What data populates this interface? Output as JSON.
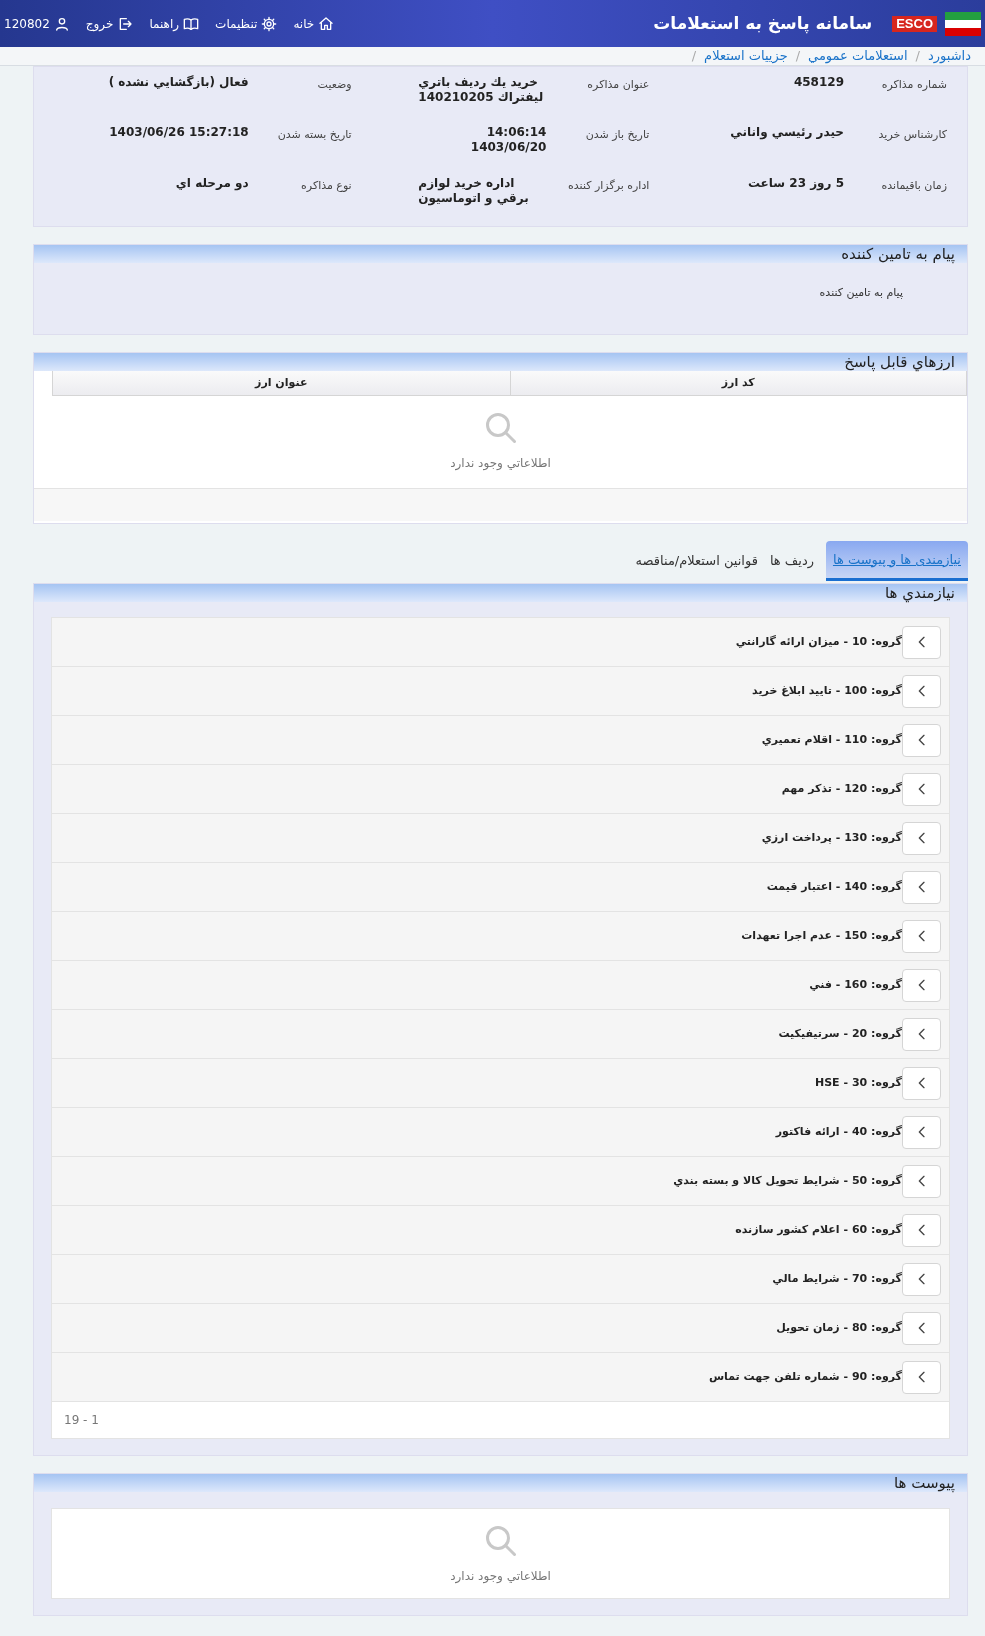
{
  "header": {
    "title": "سامانه پاسخ به استعلامات",
    "logo_text": "ESCO",
    "nav": [
      {
        "kind": "home",
        "label": "خانه"
      },
      {
        "kind": "settings",
        "label": "تنظيمات"
      },
      {
        "kind": "guide",
        "label": "راهنما"
      },
      {
        "kind": "exit",
        "label": "خروج"
      },
      {
        "kind": "user",
        "label": "120802"
      }
    ]
  },
  "breadcrumb": [
    "داشبورد",
    "استعلامات عمومي",
    "جزييات استعلام"
  ],
  "breadcrumb_separator": "/",
  "details": [
    {
      "label": "شماره مذاكره",
      "value": "458129"
    },
    {
      "label": "عنوان مذاكره",
      "value": "خريد يك رديف باتري ليفتراك 140210205"
    },
    {
      "label": "وضعيت",
      "value": "فعال (بازگشايي نشده )"
    },
    {
      "label": "كارشناس خريد",
      "value": "حيدر رئيسي واناني"
    },
    {
      "label": "تاريخ باز شدن",
      "value": "14:06:14 1403/06/20"
    },
    {
      "label": "تاريخ بسته شدن",
      "value": "1403/06/26 15:27:18"
    },
    {
      "label": "زمان باقيمانده",
      "value": "5 روز 23 ساعت"
    },
    {
      "label": "اداره برگزار كننده",
      "value": "اداره خريد لوازم برقي و اتوماسيون"
    },
    {
      "label": "نوع مذاكره",
      "value": "دو مرحله اي"
    }
  ],
  "message_panel": {
    "title": "پيام به تامين كننده",
    "text": "پيام به تامين كننده"
  },
  "currency_panel": {
    "title": "ارزهاي قابل پاسخ",
    "columns": [
      "كد ارز",
      "عنوان ارز"
    ],
    "empty_text": "اطلاعاتي وجود ندارد"
  },
  "tabs": [
    {
      "label": "نيازمندی ها و پیوست ها",
      "selected": true
    },
    {
      "label": "رديف ها",
      "selected": false
    },
    {
      "label": "قوانين استعلام/مناقصه",
      "selected": false
    }
  ],
  "needs_panel": {
    "title": "نيازمندي ها",
    "groups": [
      "گروه: 10 - ميزان ارائه گارانتي",
      "گروه: 100 - تاييد ابلاغ خريد",
      "گروه: 110 - اقلام تعميري",
      "گروه: 120 - تذكر مهم",
      "گروه: 130 - پرداخت ارزي",
      "گروه: 140 - اعتبار قيمت",
      "گروه: 150 - عدم اجرا تعهدات",
      "گروه: 160 - فني",
      "گروه: 20 - سرتيفيكيت",
      "گروه: 30 - HSE",
      "گروه: 40 - ارائه فاكتور",
      "گروه: 50 - شرايط تحويل كالا و بسته بندي",
      "گروه: 60 - اعلام كشور سازنده",
      "گروه: 70 - شرايط مالي",
      "گروه: 80 - زمان تحويل",
      "گروه: 90 - شماره تلفن جهت تماس"
    ],
    "pager": "19 - 1"
  },
  "attachments_panel": {
    "title": "پيوست ها",
    "empty_text": "اطلاعاتي وجود ندارد"
  }
}
